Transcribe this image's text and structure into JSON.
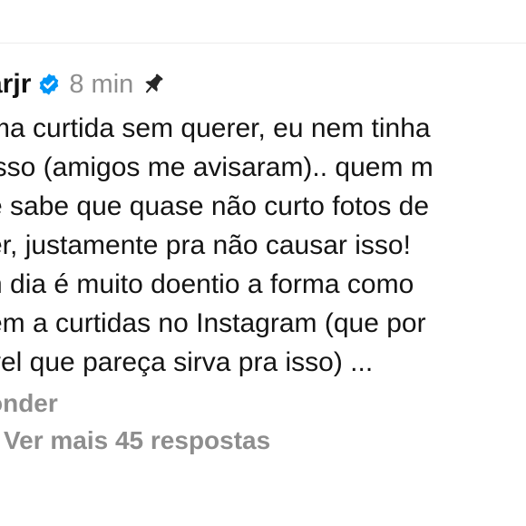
{
  "comment": {
    "username": "arjr",
    "time": "8 min",
    "lines": [
      "ma curtida sem querer, eu nem tinha",
      " isso (amigos me avisaram).. quem m",
      "e sabe que quase não curto fotos de",
      "er, justamente pra não causar isso!",
      "n dia é muito doentio a forma como",
      "em a curtidas no Instagram (que por",
      "vel que pareça sirva pra isso) ..."
    ],
    "reply_label": "onder"
  },
  "more_replies": {
    "label": "Ver mais 45 respostas"
  },
  "icons": {
    "verified": "verified-badge-icon",
    "pin": "pin-icon"
  },
  "colors": {
    "verified_blue": "#0095f6",
    "muted_text": "#8e8e8e",
    "text": "#141414"
  }
}
